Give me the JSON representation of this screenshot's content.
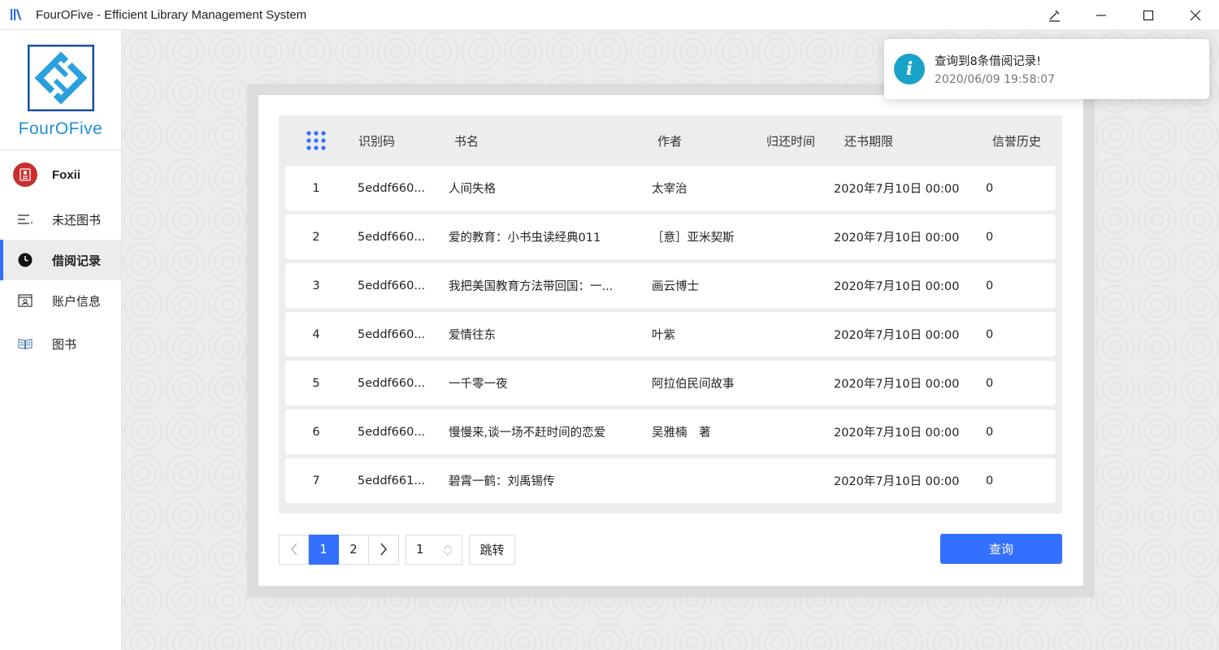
{
  "window": {
    "title": "FourOFive - Efficient Library Management System"
  },
  "sidebar": {
    "logo_text": "FourOFive",
    "user_name": "Foxii",
    "items": [
      {
        "label": "未还图书",
        "icon": "list-icon"
      },
      {
        "label": "借阅记录",
        "icon": "clock-icon",
        "active": true
      },
      {
        "label": "账户信息",
        "icon": "id-card-icon"
      },
      {
        "label": "图书",
        "icon": "book-icon"
      }
    ]
  },
  "table": {
    "headers": {
      "index_icon": "grid-dots-icon",
      "code": "识别码",
      "name": "书名",
      "author": "作者",
      "return_time": "归还时间",
      "due": "还书期限",
      "credit": "信誉历史"
    },
    "rows": [
      {
        "idx": "1",
        "code": "5eddf660...",
        "name": "人间失格",
        "author": "太宰治",
        "return_time": "",
        "due": "2020年7月10日 00:00",
        "credit": "0"
      },
      {
        "idx": "2",
        "code": "5eddf660...",
        "name": "爱的教育：小书虫读经典011",
        "author": "［意］亚米契斯",
        "return_time": "",
        "due": "2020年7月10日 00:00",
        "credit": "0"
      },
      {
        "idx": "3",
        "code": "5eddf660...",
        "name": "我把美国教育方法带回国：一...",
        "author": "画云博士",
        "return_time": "",
        "due": "2020年7月10日 00:00",
        "credit": "0"
      },
      {
        "idx": "4",
        "code": "5eddf660...",
        "name": "爱情往东",
        "author": "叶紫",
        "return_time": "",
        "due": "2020年7月10日 00:00",
        "credit": "0"
      },
      {
        "idx": "5",
        "code": "5eddf660...",
        "name": "一千零一夜",
        "author": "阿拉伯民间故事",
        "return_time": "",
        "due": "2020年7月10日 00:00",
        "credit": "0"
      },
      {
        "idx": "6",
        "code": "5eddf660...",
        "name": "慢慢来,谈一场不赶时间的恋爱",
        "author": "吴雅楠　著",
        "return_time": "",
        "due": "2020年7月10日 00:00",
        "credit": "0"
      },
      {
        "idx": "7",
        "code": "5eddf661...",
        "name": "碧霄一鹤：刘禹锡传",
        "author": "",
        "return_time": "",
        "due": "2020年7月10日 00:00",
        "credit": "0"
      }
    ]
  },
  "pagination": {
    "pages": [
      "1",
      "2"
    ],
    "current": "1",
    "jump_value": "1",
    "jump_label": "跳转"
  },
  "query_button": "查询",
  "toast": {
    "title": "查询到8条借阅记录!",
    "time": "2020/06/09 19:58:07",
    "icon": "info-icon",
    "icon_glyph": "i"
  },
  "colors": {
    "accent": "#3370ff",
    "avatar": "#c8302f",
    "toast_icon": "#1aa3c9",
    "logo": "#1e8fd6"
  }
}
